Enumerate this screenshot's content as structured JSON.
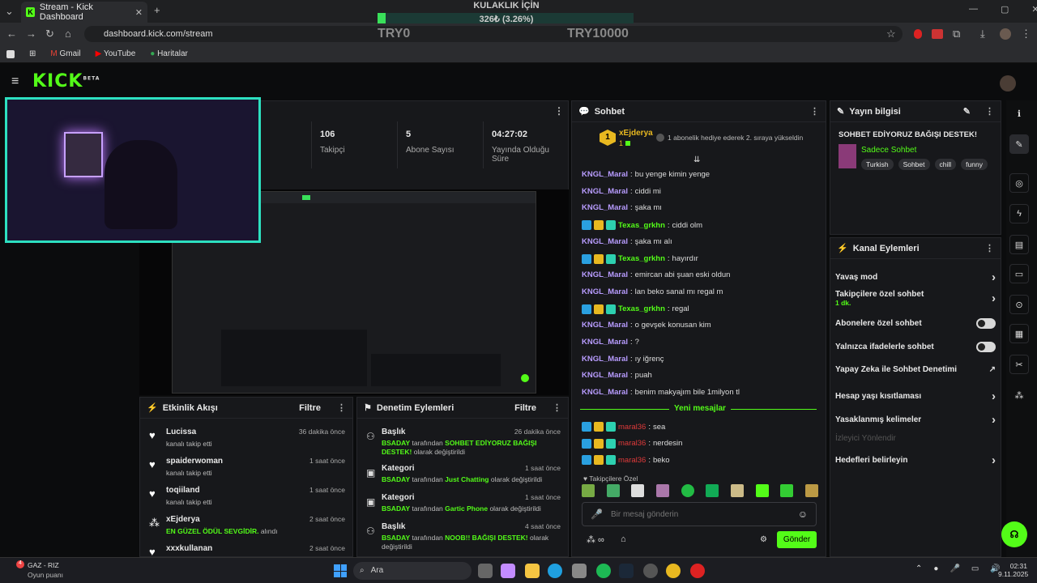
{
  "browser": {
    "tab_title": "Stream - Kick Dashboard",
    "url": "dashboard.kick.com/stream",
    "bookmarks": [
      "Gmail",
      "YouTube",
      "Haritalar"
    ]
  },
  "overlay": {
    "title": "KULAKLIK İÇİN",
    "amount": "326₺ (3.26%)",
    "min": "TRY0",
    "max": "TRY10000",
    "progress": 0.0326
  },
  "kick": {
    "logo": "KICK",
    "beta": "BETA"
  },
  "stats": {
    "followers": "106",
    "followers_label": "Takipçi",
    "subs": "5",
    "subs_label": "Abone Sayısı",
    "uptime": "04:27:02",
    "uptime_label": "Yayında Olduğu Süre"
  },
  "chat": {
    "title": "Sohbet",
    "pinned_user": "xEjderya",
    "pinned_level": "1",
    "pinned_text": "1 abonelik hediye ederek 2. sıraya yükseldin",
    "messages": [
      {
        "user": "KNGL_Maral",
        "text": "bu yenge kimin yenge",
        "color": "#b89cff",
        "badges": false
      },
      {
        "user": "KNGL_Maral",
        "text": "ciddi mi",
        "color": "#b89cff",
        "badges": false
      },
      {
        "user": "KNGL_Maral",
        "text": "şaka mı",
        "color": "#b89cff",
        "badges": false
      },
      {
        "user": "Texas_grkhn",
        "text": "ciddi olm",
        "color": "#53fc18",
        "badges": true
      },
      {
        "user": "KNGL_Maral",
        "text": "şaka mı alı",
        "color": "#b89cff",
        "badges": false
      },
      {
        "user": "Texas_grkhn",
        "text": "hayırdır",
        "color": "#53fc18",
        "badges": true
      },
      {
        "user": "KNGL_Maral",
        "text": "emircan abi şuan eski oldun",
        "color": "#b89cff",
        "badges": false
      },
      {
        "user": "KNGL_Maral",
        "text": "lan beko sanal mı regal m",
        "color": "#b89cff",
        "badges": false
      },
      {
        "user": "Texas_grkhn",
        "text": "regal",
        "color": "#53fc18",
        "badges": true
      },
      {
        "user": "KNGL_Maral",
        "text": "o gevşek konusan kim",
        "color": "#b89cff",
        "badges": false
      },
      {
        "user": "KNGL_Maral",
        "text": "?",
        "color": "#b89cff",
        "badges": false
      },
      {
        "user": "KNGL_Maral",
        "text": "ıy iğrenç",
        "color": "#b89cff",
        "badges": false
      },
      {
        "user": "KNGL_Maral",
        "text": "puah",
        "color": "#b89cff",
        "badges": false
      },
      {
        "user": "KNGL_Maral",
        "text": "benim makyajım bile 1milyon tl",
        "color": "#b89cff",
        "badges": false
      }
    ],
    "new_messages": "Yeni mesajlar",
    "new": [
      {
        "user": "maral36",
        "text": "sea"
      },
      {
        "user": "maral36",
        "text": "nerdesin"
      },
      {
        "user": "maral36",
        "text": "beko"
      }
    ],
    "followers_only": "Takipçilere Özel",
    "placeholder": "Bir mesaj gönderin",
    "send": "Gönder"
  },
  "info": {
    "title": "Yayın bilgisi",
    "stream_title": "SOHBET EDİYORUZ BAĞIŞI DESTEK!",
    "category": "Sadece Sohbet",
    "tags": [
      "Turkish",
      "Sohbet",
      "chill",
      "funny"
    ]
  },
  "actions": {
    "title": "Kanal Eylemleri",
    "items": [
      {
        "label": "Yavaş mod",
        "type": "chevron"
      },
      {
        "label": "Takipçilere özel sohbet",
        "sub": "1 dk.",
        "type": "chevron"
      },
      {
        "label": "Abonelere özel sohbet",
        "type": "toggle"
      },
      {
        "label": "Yalnızca ifadelerle sohbet",
        "type": "toggle"
      },
      {
        "label": "Yapay Zeka ile Sohbet Denetimi",
        "type": "external"
      },
      {
        "label": "Hesap yaşı kısıtlaması",
        "type": "chevron"
      },
      {
        "label": "Yasaklanmış kelimeler",
        "type": "chevron"
      },
      {
        "label": "İzleyici Yönlendir",
        "type": "disabled"
      },
      {
        "label": "Hedefleri belirleyin",
        "type": "chevron"
      }
    ]
  },
  "activity": {
    "title": "Etkinlik Akışı",
    "filter": "Filtre",
    "items": [
      {
        "user": "Lucissa",
        "text": "kanalı takip etti",
        "time": "36 dakika önce"
      },
      {
        "user": "spaiderwoman",
        "text": "kanalı takip etti",
        "time": "1 saat önce"
      },
      {
        "user": "toqiiland",
        "text": "kanalı takip etti",
        "time": "1 saat önce"
      },
      {
        "user": "xEjderya",
        "text": "alındı",
        "highlight": "EN GÜZEL ÖDÜL SEVGİDİR.",
        "time": "2 saat önce"
      },
      {
        "user": "xxxkullanan",
        "text": "",
        "time": "2 saat önce"
      }
    ]
  },
  "moderation": {
    "title": "Denetim Eylemleri",
    "filter": "Filtre",
    "items": [
      {
        "type": "Başlık",
        "by": "BSADAY",
        "mid": "tarafından",
        "value": "SOHBET EDİYORUZ BAĞIŞI DESTEK!",
        "end": "olarak değiştirildi",
        "time": "26 dakika önce"
      },
      {
        "type": "Kategori",
        "by": "BSADAY",
        "mid": "tarafından",
        "value": "Just Chatting",
        "end": "olarak değiştirildi",
        "time": "1 saat önce"
      },
      {
        "type": "Kategori",
        "by": "BSADAY",
        "mid": "tarafından",
        "value": "Gartic Phone",
        "end": "olarak değiştirildi",
        "time": "1 saat önce"
      },
      {
        "type": "Başlık",
        "by": "BSADAY",
        "mid": "tarafından",
        "value": "NOOB!! BAĞIŞI DESTEK!",
        "end": "olarak değiştirildi",
        "time": "4 saat önce"
      }
    ]
  },
  "taskbar": {
    "widget_title": "GAZ - RIZ",
    "widget_sub": "Oyun puanı",
    "search": "Ara",
    "time": "02:31",
    "date": "9.11.2025"
  }
}
